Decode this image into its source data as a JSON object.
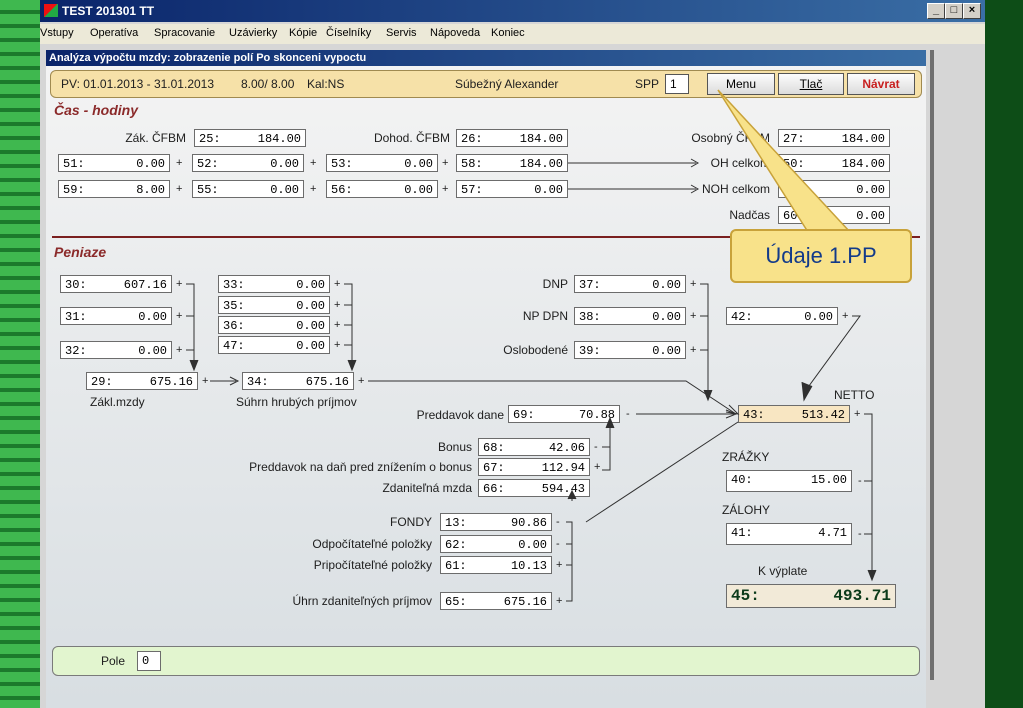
{
  "window": {
    "title": "TEST 201301 TT"
  },
  "menu": [
    "Vstupy",
    "Operatíva",
    "Spracovanie",
    "Uzávierky",
    "Kópie",
    "Číselníky",
    "Servis",
    "Nápoveda",
    "Koniec"
  ],
  "form": {
    "title": "Analýza výpočtu mzdy: zobrazenie polí Po skonceni vypoctu",
    "period": "PV: 01.01.2013 - 31.01.2013",
    "hours": "8.00/ 8.00",
    "kal": "Kal:NS",
    "employee": "Súbežný Alexander",
    "spp_label": "SPP",
    "spp_value": "1",
    "btn_menu": "Menu",
    "btn_tlac": "Tlač",
    "btn_navrat": "Návrat"
  },
  "cas": {
    "heading": "Čas - hodiny",
    "zak_cfbm_label": "Zák. ČFBM",
    "f25": {
      "k": "25:",
      "v": "184.00"
    },
    "dohod_cfbm_label": "Dohod. ČFBM",
    "f26": {
      "k": "26:",
      "v": "184.00"
    },
    "osobny_cfbm_label": "Osobný ČFBM",
    "f27": {
      "k": "27:",
      "v": "184.00"
    },
    "f51": {
      "k": "51:",
      "v": "0.00"
    },
    "f52": {
      "k": "52:",
      "v": "0.00"
    },
    "f53": {
      "k": "53:",
      "v": "0.00"
    },
    "f58": {
      "k": "58:",
      "v": "184.00"
    },
    "oh_label": "OH celkom",
    "f50": {
      "k": "50:",
      "v": "184.00"
    },
    "f59": {
      "k": "59:",
      "v": "8.00"
    },
    "f55": {
      "k": "55:",
      "v": "0.00"
    },
    "f56": {
      "k": "56:",
      "v": "0.00"
    },
    "f57": {
      "k": "57:",
      "v": "0.00"
    },
    "noh_label": "NOH celkom",
    "f54": {
      "k": "54:",
      "v": "0.00"
    },
    "nadcas_label": "Nadčas",
    "f60": {
      "k": "60:",
      "v": "0.00"
    }
  },
  "peniaze": {
    "heading": "Peniaze",
    "f30": {
      "k": "30:",
      "v": "607.16"
    },
    "f31": {
      "k": "31:",
      "v": "0.00"
    },
    "f32": {
      "k": "32:",
      "v": "0.00"
    },
    "f33": {
      "k": "33:",
      "v": "0.00"
    },
    "f35": {
      "k": "35:",
      "v": "0.00"
    },
    "f36": {
      "k": "36:",
      "v": "0.00"
    },
    "f47": {
      "k": "47:",
      "v": "0.00"
    },
    "f29": {
      "k": "29:",
      "v": "675.16"
    },
    "zakl_label": "Zákl.mzdy",
    "f34": {
      "k": "34:",
      "v": "675.16"
    },
    "suhrn_label": "Súhrn hrubých príjmov",
    "dnp_label": "DNP",
    "f37": {
      "k": "37:",
      "v": "0.00"
    },
    "npdpn_label": "NP DPN",
    "f38": {
      "k": "38:",
      "v": "0.00"
    },
    "oslob_label": "Oslobodené",
    "f39": {
      "k": "39:",
      "v": "0.00"
    },
    "f42": {
      "k": "42:",
      "v": "0.00"
    },
    "preddavok_label": "Preddavok dane",
    "f69": {
      "k": "69:",
      "v": "70.88"
    },
    "netto_label": "NETTO",
    "f43": {
      "k": "43:",
      "v": "513.42"
    },
    "bonus_label": "Bonus",
    "f68": {
      "k": "68:",
      "v": "42.06"
    },
    "predbonus_label": "Preddavok na daň pred znížením o bonus",
    "f67": {
      "k": "67:",
      "v": "112.94"
    },
    "zdanitelna_label": "Zdaniteľná mzda",
    "f66": {
      "k": "66:",
      "v": "594.43"
    },
    "zrazky_label": "ZRÁŽKY",
    "f40": {
      "k": "40:",
      "v": "15.00"
    },
    "zalohy_label": "ZÁLOHY",
    "f41": {
      "k": "41:",
      "v": "4.71"
    },
    "fondy_label": "FONDY",
    "f13": {
      "k": "13:",
      "v": "90.86"
    },
    "odpoc_label": "Odpočítateľné položky",
    "f62": {
      "k": "62:",
      "v": "0.00"
    },
    "pripoc_label": "Pripočítateľné položky",
    "f61": {
      "k": "61:",
      "v": "10.13"
    },
    "kvyplate_label": "K výplate",
    "f45": {
      "k": "45:",
      "v": "493.71"
    },
    "uhrn_label": "Úhrn zdaniteľných príjmov",
    "f65": {
      "k": "65:",
      "v": "675.16"
    }
  },
  "status": {
    "pole_label": "Pole",
    "pole_value": "0"
  },
  "callout": {
    "text": "Údaje 1.PP"
  },
  "colors": {
    "accent": "#8b2a2a",
    "callout_bg": "#f8e28a",
    "callout_text": "#123a8a",
    "navrat": "#c81e1e"
  }
}
